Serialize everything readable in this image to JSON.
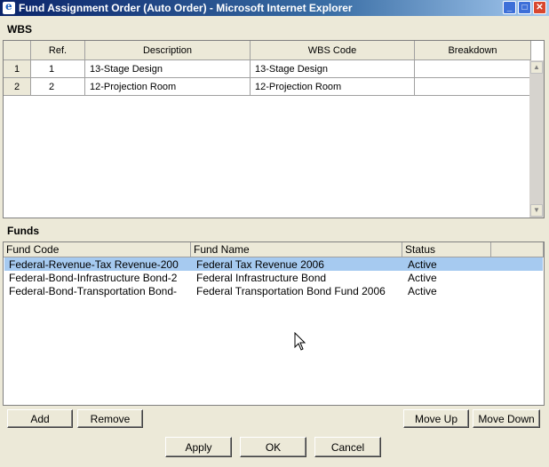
{
  "window": {
    "title": "Fund Assignment Order (Auto Order) - Microsoft Internet Explorer",
    "minimize": "_",
    "maximize": "□",
    "close": "✕"
  },
  "wbs": {
    "label": "WBS",
    "columns": [
      "",
      "Ref.",
      "Description",
      "WBS Code",
      "Breakdown"
    ],
    "rows": [
      {
        "num": "1",
        "ref": "1",
        "description": "13-Stage Design",
        "wbs_code": "13-Stage Design",
        "breakdown": ""
      },
      {
        "num": "2",
        "ref": "2",
        "description": "12-Projection Room",
        "wbs_code": "12-Projection Room",
        "breakdown": ""
      }
    ]
  },
  "funds": {
    "label": "Funds",
    "columns": [
      "Fund Code",
      "Fund Name",
      "Status"
    ],
    "rows": [
      {
        "code": "Federal-Revenue-Tax Revenue-200",
        "name": "Federal Tax Revenue 2006",
        "status": "Active",
        "selected": true
      },
      {
        "code": "Federal-Bond-Infrastructure Bond-2",
        "name": "Federal Infrastructure Bond",
        "status": "Active",
        "selected": false
      },
      {
        "code": "Federal-Bond-Transportation Bond-",
        "name": "Federal Transportation Bond Fund 2006",
        "status": "Active",
        "selected": false
      }
    ]
  },
  "buttons": {
    "add": "Add",
    "remove": "Remove",
    "move_up": "Move Up",
    "move_down": "Move Down",
    "apply": "Apply",
    "ok": "OK",
    "cancel": "Cancel"
  },
  "colors": {
    "selection": "#a6caf0",
    "dialog_bg": "#ece9d8",
    "title_bar": "#0a246a"
  }
}
